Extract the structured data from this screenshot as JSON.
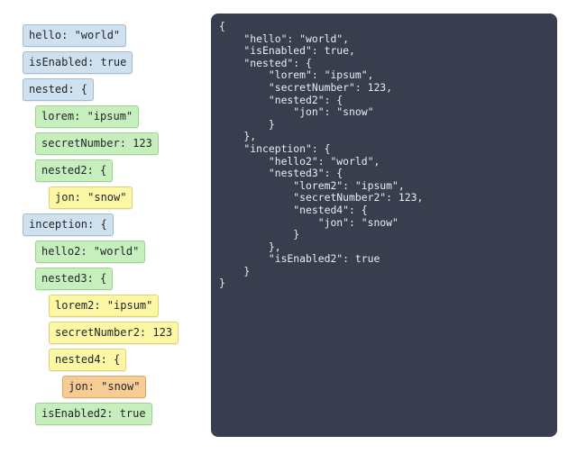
{
  "tree_items": [
    {
      "label": "hello: \"world\""
    },
    {
      "label": "isEnabled: true"
    },
    {
      "label": "nested: {"
    },
    {
      "label": "lorem: \"ipsum\""
    },
    {
      "label": "secretNumber: 123"
    },
    {
      "label": "nested2: {"
    },
    {
      "label": "jon: \"snow\""
    },
    {
      "label": "inception: {"
    },
    {
      "label": "hello2: \"world\""
    },
    {
      "label": "nested3: {"
    },
    {
      "label": "lorem2: \"ipsum\""
    },
    {
      "label": "secretNumber2: 123"
    },
    {
      "label": "nested4: {"
    },
    {
      "label": "jon: \"snow\""
    },
    {
      "label": "isEnabled2: true"
    }
  ],
  "json_output": "{\n    \"hello\": \"world\",\n    \"isEnabled\": true,\n    \"nested\": {\n        \"lorem\": \"ipsum\",\n        \"secretNumber\": 123,\n        \"nested2\": {\n            \"jon\": \"snow\"\n        }\n    },\n    \"inception\": {\n        \"hello2\": \"world\",\n        \"nested3\": {\n            \"lorem2\": \"ipsum\",\n            \"secretNumber2\": 123,\n            \"nested4\": {\n                \"jon\": \"snow\"\n            }\n        },\n        \"isEnabled2\": true\n    }\n}",
  "colors": {
    "depth0": "#cfe0ef",
    "depth1": "#c6efbd",
    "depth2": "#fbf7a4",
    "depth3": "#f7cc94",
    "code_background": "#383e4e",
    "code_text": "#e9ecf2"
  }
}
